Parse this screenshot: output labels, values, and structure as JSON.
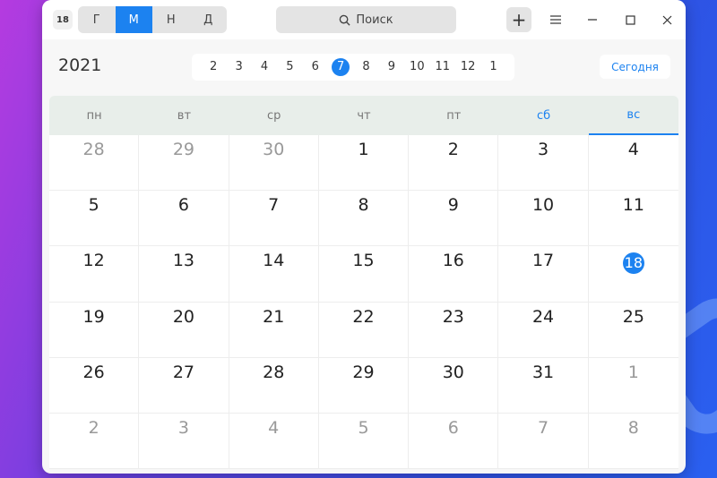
{
  "app": {
    "icon_text": "18"
  },
  "view_switch": [
    {
      "label": "Г",
      "active": false
    },
    {
      "label": "М",
      "active": true
    },
    {
      "label": "Н",
      "active": false
    },
    {
      "label": "Д",
      "active": false
    }
  ],
  "search": {
    "label": "Поиск"
  },
  "toolbar": {
    "add_label": "+"
  },
  "header": {
    "year": "2021",
    "today_label": "Сегодня",
    "months": [
      "2",
      "3",
      "4",
      "5",
      "6",
      "7",
      "8",
      "9",
      "10",
      "11",
      "12",
      "1"
    ],
    "active_month_index": 5
  },
  "weekdays": [
    "пн",
    "вт",
    "ср",
    "чт",
    "пт",
    "сб",
    "вс"
  ],
  "colors": {
    "accent": "#1c82f0"
  },
  "calendar": {
    "days": [
      {
        "d": "28",
        "other": true
      },
      {
        "d": "29",
        "other": true
      },
      {
        "d": "30",
        "other": true
      },
      {
        "d": "1"
      },
      {
        "d": "2"
      },
      {
        "d": "3"
      },
      {
        "d": "4"
      },
      {
        "d": "5"
      },
      {
        "d": "6"
      },
      {
        "d": "7"
      },
      {
        "d": "8"
      },
      {
        "d": "9"
      },
      {
        "d": "10"
      },
      {
        "d": "11"
      },
      {
        "d": "12"
      },
      {
        "d": "13"
      },
      {
        "d": "14"
      },
      {
        "d": "15"
      },
      {
        "d": "16"
      },
      {
        "d": "17"
      },
      {
        "d": "18",
        "today": true
      },
      {
        "d": "19"
      },
      {
        "d": "20"
      },
      {
        "d": "21"
      },
      {
        "d": "22"
      },
      {
        "d": "23"
      },
      {
        "d": "24"
      },
      {
        "d": "25"
      },
      {
        "d": "26"
      },
      {
        "d": "27"
      },
      {
        "d": "28"
      },
      {
        "d": "29"
      },
      {
        "d": "30"
      },
      {
        "d": "31"
      },
      {
        "d": "1",
        "other": true
      },
      {
        "d": "2",
        "other": true
      },
      {
        "d": "3",
        "other": true
      },
      {
        "d": "4",
        "other": true
      },
      {
        "d": "5",
        "other": true
      },
      {
        "d": "6",
        "other": true
      },
      {
        "d": "7",
        "other": true
      },
      {
        "d": "8",
        "other": true
      }
    ]
  }
}
